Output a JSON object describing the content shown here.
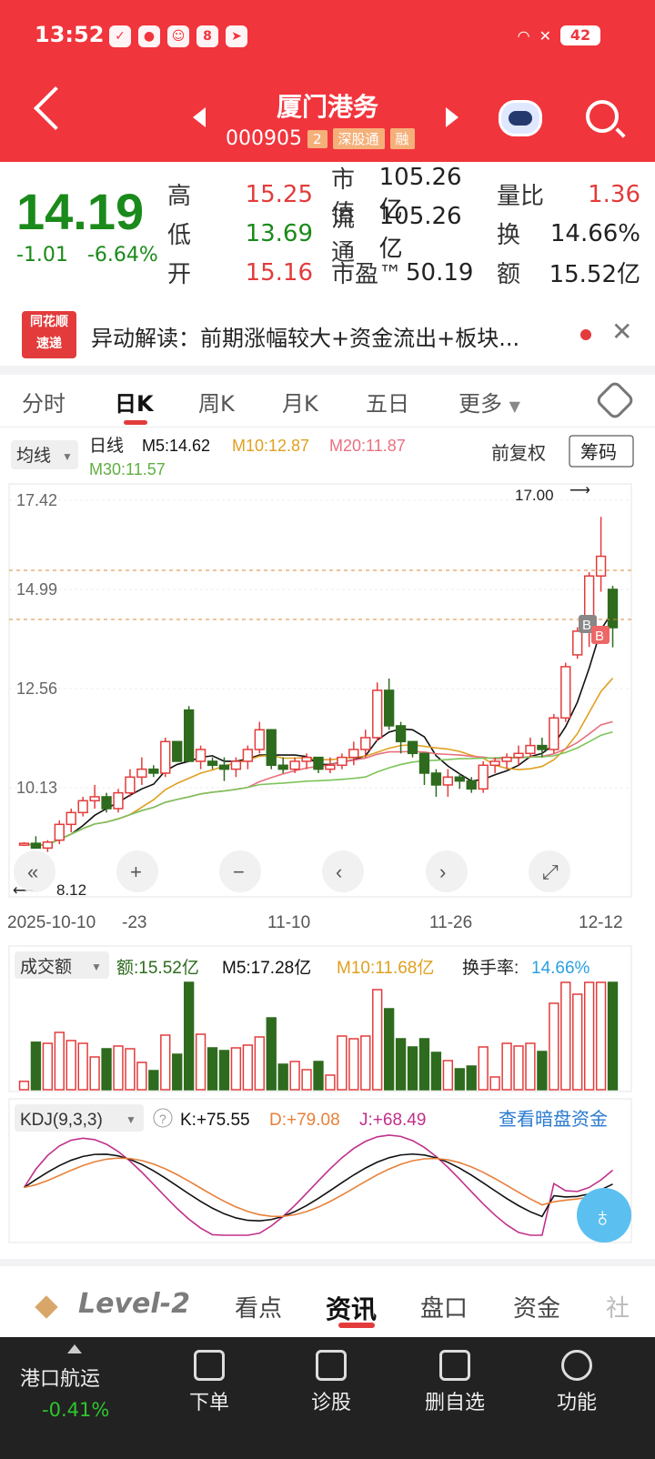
{
  "status": {
    "time": "13:52",
    "battery": "42"
  },
  "header": {
    "title": "厦门港务",
    "code": "000905",
    "tag_num": "2",
    "tag_sz": "深股通",
    "tag_more": "融"
  },
  "quote": {
    "price": "14.19",
    "change": "-1.01",
    "change_pct": "-6.64%",
    "high_label": "高",
    "high": "15.25",
    "low_label": "低",
    "low": "13.69",
    "open_label": "开",
    "open": "15.16",
    "mcap_label": "市值",
    "mcap": "105.26亿",
    "float_label": "流通",
    "float": "105.26亿",
    "pe_label": "市盈™",
    "pe": "50.19",
    "vr_label": "量比",
    "vr": "1.36",
    "turn_label": "换",
    "turn": "14.66%",
    "amt_label": "额",
    "amt": "15.52亿"
  },
  "news": {
    "logo_top": "同花顺",
    "logo_bottom": "速递",
    "text": "异动解读：前期涨幅较大+资金流出+板块..."
  },
  "tabs": [
    "分时",
    "日K",
    "周K",
    "月K",
    "五日",
    "更多"
  ],
  "chart_header": {
    "ma_select": "均线",
    "period": "日线",
    "m5": "M5:14.62",
    "m10": "M10:12.87",
    "m20": "M20:11.87",
    "m30": "M30:11.57",
    "adjust": "前复权",
    "chips": "筹码"
  },
  "chart_data": {
    "type": "candlestick",
    "ylabels": [
      "17.42",
      "14.99",
      "12.56",
      "10.13"
    ],
    "xlabels": [
      "2025-10-10",
      "-23",
      "11-10",
      "11-26",
      "12-12"
    ],
    "max_label": "17.00",
    "min_label": "8.12",
    "colors": {
      "up": "#e33b3b",
      "down": "#2e6b1e",
      "m5": "#111111",
      "m10": "#e0a020",
      "m20": "#e87080",
      "m30": "#7cc45a"
    }
  },
  "nav_buttons": [
    "«",
    "+",
    "−",
    "‹",
    "›",
    "⤢"
  ],
  "volume": {
    "select": "成交额",
    "amount": "额:15.52亿",
    "m5": "M5:17.28亿",
    "m10": "M10:11.68亿",
    "turn_label": "换手率:",
    "turn": "14.66%"
  },
  "kdj": {
    "select": "KDJ(9,3,3)",
    "k": "K:+75.55",
    "d": "D:+79.08",
    "j": "J:+68.49",
    "link": "查看暗盘资金"
  },
  "lower_tabs": {
    "brand": "Level-2",
    "items": [
      "看点",
      "资讯",
      "盘口",
      "资金",
      "社"
    ]
  },
  "bottom": {
    "index_name": "港口航运",
    "index_change": "-0.41%",
    "items": [
      "下单",
      "诊股",
      "删自选",
      "功能"
    ]
  }
}
